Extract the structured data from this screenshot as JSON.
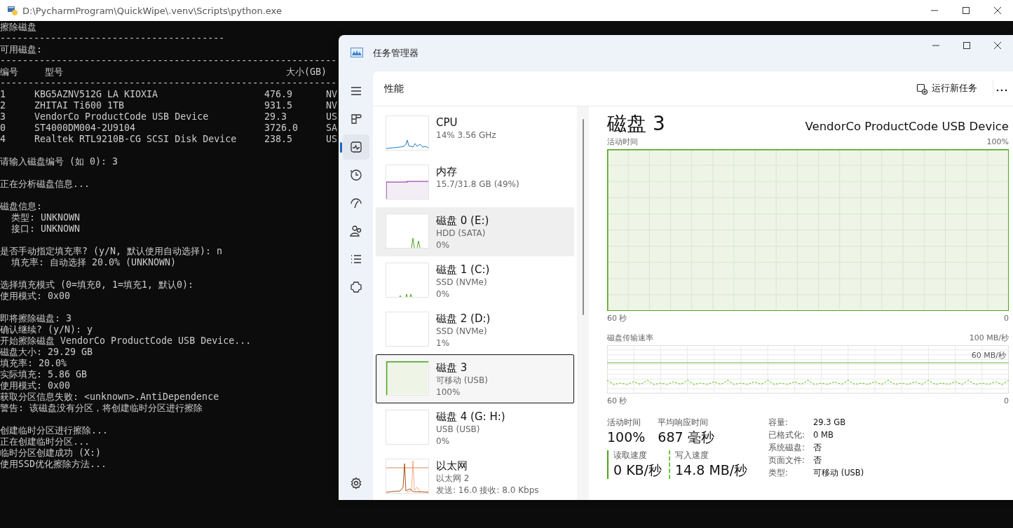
{
  "console": {
    "title": "D:\\PycharmProgram\\QuickWipe\\.venv\\Scripts\\python.exe",
    "lines": [
      {
        "kind": "text",
        "text": "擦除磁盘"
      },
      {
        "kind": "rule",
        "text": "----------------------------------------"
      },
      {
        "kind": "text",
        "text": "可用磁盘:"
      },
      {
        "kind": "rule",
        "text": "------------------------------------------------------------"
      },
      {
        "kind": "header",
        "cells": [
          "编号",
          "型号",
          "大小(GB)"
        ]
      },
      {
        "kind": "rule",
        "text": "------------------------------------------------------------"
      },
      {
        "kind": "row",
        "cells": [
          "1",
          "KBG5AZNV512G LA KIOXIA",
          "476.9",
          "NV"
        ]
      },
      {
        "kind": "row",
        "cells": [
          "2",
          "ZHITAI Ti600 1TB",
          "931.5",
          "NV"
        ]
      },
      {
        "kind": "row",
        "cells": [
          "3",
          "VendorCo ProductCode USB Device",
          "29.3",
          "US"
        ]
      },
      {
        "kind": "row",
        "cells": [
          "0",
          "ST4000DM004-2U9104",
          "3726.0",
          "SA"
        ]
      },
      {
        "kind": "row",
        "cells": [
          "4",
          "Realtek RTL9210B-CG SCSI Disk Device",
          "238.5",
          "US"
        ]
      },
      {
        "kind": "gap"
      },
      {
        "kind": "text",
        "text": "请输入磁盘编号 (如 0): 3"
      },
      {
        "kind": "gap"
      },
      {
        "kind": "text",
        "text": "正在分析磁盘信息..."
      },
      {
        "kind": "gap"
      },
      {
        "kind": "text",
        "text": "磁盘信息:"
      },
      {
        "kind": "text",
        "text": "  类型: UNKNOWN"
      },
      {
        "kind": "text",
        "text": "  接口: UNKNOWN"
      },
      {
        "kind": "gap"
      },
      {
        "kind": "text",
        "text": "是否手动指定填充率? (y/N, 默认使用自动选择): n"
      },
      {
        "kind": "text",
        "text": "  填充率: 自动选择 20.0% (UNKNOWN)"
      },
      {
        "kind": "gap"
      },
      {
        "kind": "text",
        "text": "选择填充模式 (0=填充0, 1=填充1, 默认0):"
      },
      {
        "kind": "text",
        "text": "使用模式: 0x00"
      },
      {
        "kind": "gap"
      },
      {
        "kind": "text",
        "text": "即将擦除磁盘: 3"
      },
      {
        "kind": "text",
        "text": "确认继续? (y/N): y"
      },
      {
        "kind": "text",
        "text": "开始擦除磁盘 VendorCo ProductCode USB Device..."
      },
      {
        "kind": "text",
        "text": "磁盘大小: 29.29 GB"
      },
      {
        "kind": "text",
        "text": "填充率: 20.0%"
      },
      {
        "kind": "text",
        "text": "实际填充: 5.86 GB"
      },
      {
        "kind": "text",
        "text": "使用模式: 0x00"
      },
      {
        "kind": "text",
        "text": "获取分区信息失败: <unknown>.AntiDependence"
      },
      {
        "kind": "text",
        "text": "警告: 该磁盘没有分区，将创建临时分区进行擦除"
      },
      {
        "kind": "gap"
      },
      {
        "kind": "text",
        "text": "创建临时分区进行擦除..."
      },
      {
        "kind": "text",
        "text": "正在创建临时分区..."
      },
      {
        "kind": "text",
        "text": "临时分区创建成功 (X:)"
      },
      {
        "kind": "text",
        "text": "使用SSD优化擦除方法..."
      }
    ]
  },
  "task_manager": {
    "title": "任务管理器",
    "nav": [
      {
        "kind": "menu",
        "selected": false
      },
      {
        "kind": "processes",
        "selected": false
      },
      {
        "kind": "performance",
        "selected": true
      },
      {
        "kind": "history",
        "selected": false
      },
      {
        "kind": "startup",
        "selected": false
      },
      {
        "kind": "users",
        "selected": false
      },
      {
        "kind": "details",
        "selected": false
      },
      {
        "kind": "services",
        "selected": false
      },
      {
        "kind": "settings",
        "selected": false
      }
    ],
    "header": "性能",
    "run_task": "运行新任务",
    "list": [
      {
        "name": "CPU",
        "detail": "14% 3.56 GHz",
        "kind": "cpu",
        "hovered": false,
        "selected": false
      },
      {
        "name": "内存",
        "detail": "15.7/31.8 GB (49%)",
        "kind": "memory",
        "hovered": false,
        "selected": false
      },
      {
        "name": "磁盘 0 (E:)",
        "detail": "HDD (SATA)",
        "reading": "0%",
        "kind": "spikes",
        "hovered": true,
        "selected": false
      },
      {
        "name": "磁盘 1 (C:)",
        "detail": "SSD (NVMe)",
        "reading": "0%",
        "kind": "low",
        "hovered": false,
        "selected": false
      },
      {
        "name": "磁盘 2 (D:)",
        "detail": "SSD (NVMe)",
        "reading": "1%",
        "kind": "idle",
        "hovered": false,
        "selected": false
      },
      {
        "name": "磁盘 3",
        "detail": "可移动 (USB)",
        "reading": "100%",
        "kind": "full",
        "hovered": false,
        "selected": true
      },
      {
        "name": "磁盘 4 (G: H:)",
        "detail": "USB (USB)",
        "reading": "0%",
        "kind": "idle",
        "hovered": false,
        "selected": false
      },
      {
        "name": "以太网",
        "detail": "以太网 2",
        "reading": "发送: 16.0 接收: 8.0 Kbps",
        "kind": "network",
        "hovered": false,
        "selected": false
      }
    ],
    "detail": {
      "title": "磁盘 3",
      "device": "VendorCo ProductCode USB Device",
      "activity_chart": {
        "label": "活动时间",
        "max": "100%",
        "x_start": "60 秒",
        "x_end": "0"
      },
      "transfer_chart": {
        "label": "磁盘传输速率",
        "max": "100 MB/秒",
        "line_label": "60 MB/秒",
        "x_start": "60 秒",
        "x_end": "0"
      },
      "stats": [
        {
          "label": "活动时间",
          "value": "100%"
        },
        {
          "label": "平均响应时间",
          "value": "687 毫秒"
        }
      ],
      "speeds": [
        {
          "label": "读取速度",
          "value": "0 KB/秒",
          "kind": "solid"
        },
        {
          "label": "写入速度",
          "value": "14.8 MB/秒",
          "kind": "dashed"
        }
      ],
      "properties": [
        {
          "label": "容量:",
          "value": "29.3 GB"
        },
        {
          "label": "已格式化:",
          "value": "0 MB"
        },
        {
          "label": "系统磁盘:",
          "value": "否"
        },
        {
          "label": "页面文件:",
          "value": "否"
        },
        {
          "label": "类型:",
          "value": "可移动 (USB)"
        }
      ]
    }
  }
}
